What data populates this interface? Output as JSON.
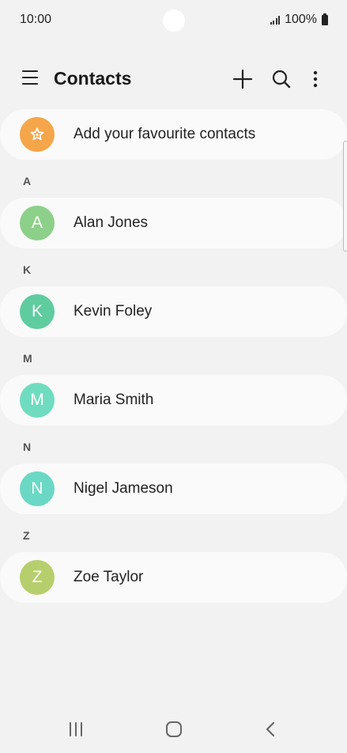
{
  "status": {
    "time": "10:00",
    "battery": "100%",
    "icons": [
      "signal-icon",
      "battery-icon"
    ]
  },
  "header": {
    "title": "Contacts",
    "icons": [
      "menu-icon",
      "add-icon",
      "search-icon",
      "more-options-icon"
    ]
  },
  "favourites": {
    "label": "Add your favourite contacts",
    "icon": "star-icon",
    "color": "#f5a64a"
  },
  "contacts": [
    {
      "section": "A",
      "initial": "A",
      "name": "Alan Jones",
      "color": "#8dd08a"
    },
    {
      "section": "K",
      "initial": "K",
      "name": "Kevin Foley",
      "color": "#5fcc9f"
    },
    {
      "section": "M",
      "initial": "M",
      "name": "Maria Smith",
      "color": "#6fdcc0"
    },
    {
      "section": "N",
      "initial": "N",
      "name": "Nigel Jameson",
      "color": "#6ad8c4"
    },
    {
      "section": "Z",
      "initial": "Z",
      "name": "Zoe Taylor",
      "color": "#b6cf6c"
    }
  ],
  "navbar": {
    "icons": [
      "recent-apps-icon",
      "home-icon",
      "back-icon"
    ]
  }
}
